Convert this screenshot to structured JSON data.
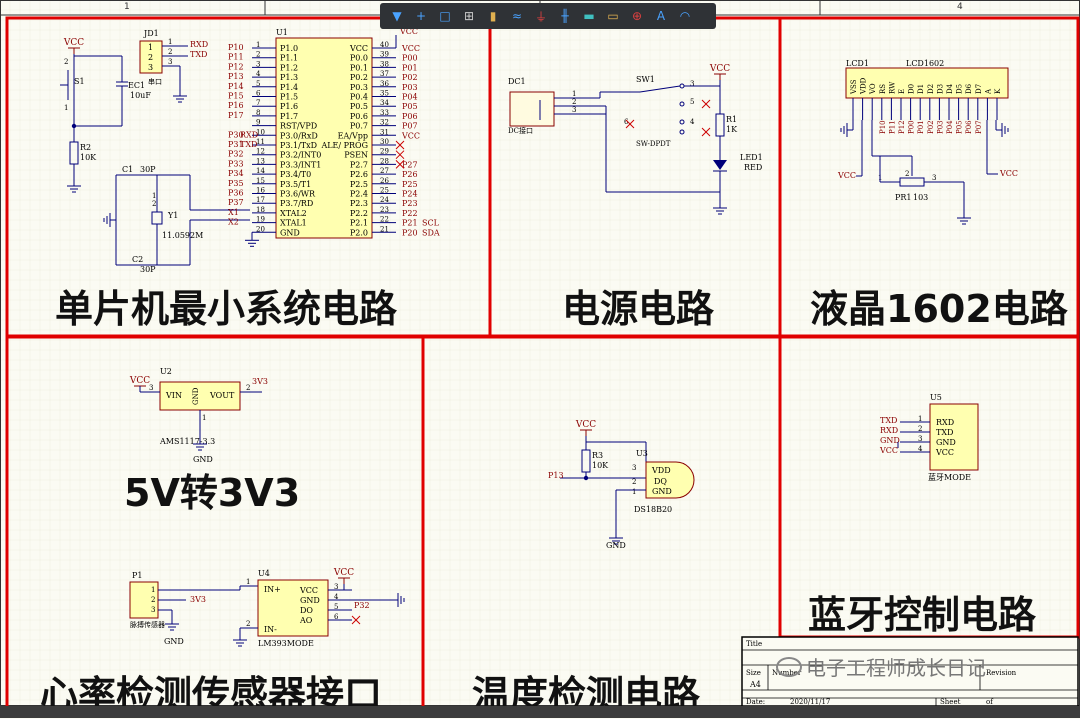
{
  "toolbar": {
    "tools": [
      {
        "name": "filter-icon",
        "glyph": "▼",
        "color": "#4aa3ff"
      },
      {
        "name": "crosshair-icon",
        "glyph": "+",
        "color": "#4aa3ff"
      },
      {
        "name": "select-rect-icon",
        "glyph": "□",
        "color": "#4aa3ff"
      },
      {
        "name": "align-icon",
        "glyph": "⊞",
        "color": "#cccccc"
      },
      {
        "name": "component-icon",
        "glyph": "▮",
        "color": "#e0b050"
      },
      {
        "name": "wire-icon",
        "glyph": "≈",
        "color": "#4aa3ff"
      },
      {
        "name": "ground-power-icon",
        "glyph": "⏚",
        "color": "#e04040"
      },
      {
        "name": "bus-icon",
        "glyph": "╫",
        "color": "#4aa3ff"
      },
      {
        "name": "sheet-symbol-icon",
        "glyph": "▬",
        "color": "#40c0c0"
      },
      {
        "name": "port-icon",
        "glyph": "▭",
        "color": "#e0b050"
      },
      {
        "name": "no-erc-icon",
        "glyph": "⊕",
        "color": "#e04040"
      },
      {
        "name": "text-icon",
        "glyph": "A",
        "color": "#4aa3ff"
      },
      {
        "name": "arc-icon",
        "glyph": "◠",
        "color": "#4aa3ff"
      }
    ]
  },
  "grid_columns": [
    "1",
    "4"
  ],
  "sections": {
    "mcu": "单片机最小系统电路",
    "power": "电源电路",
    "lcd": "液晶1602电路",
    "ldo": "5V转3V3",
    "temp": "温度检测电路",
    "bt": "蓝牙控制电路",
    "heart": "心率检测传感器接口"
  },
  "mcu": {
    "vcc": "VCC",
    "jd1": "JD1",
    "jd1_note": "串口",
    "rxd": "RXD",
    "txd": "TXD",
    "s1": "S1",
    "ec1": "EC1",
    "ec1_val": "10uF",
    "r2": "R2",
    "r2_val": "10K",
    "c1": "C1",
    "c1_val": "30P",
    "c2": "C2",
    "c2_val": "30P",
    "y1": "Y1",
    "y1_val": "11.0592M",
    "u1": "U1",
    "vcc40": "VCC",
    "pin40": "40",
    "left_nets": [
      "P10",
      "P11",
      "P12",
      "P13",
      "P14",
      "P15",
      "P16",
      "P17",
      "",
      "P30",
      "P31",
      "P32",
      "P33",
      "P34",
      "P35",
      "P36",
      "P37",
      "X1",
      "X2",
      ""
    ],
    "left_extra": [
      "",
      "",
      "",
      "",
      "",
      "",
      "",
      "",
      "",
      "RXD",
      "TXD",
      "",
      "",
      "",
      "",
      "",
      "",
      "",
      "",
      ""
    ],
    "left_nums": [
      "1",
      "2",
      "3",
      "4",
      "5",
      "6",
      "7",
      "8",
      "9",
      "10",
      "11",
      "12",
      "13",
      "14",
      "15",
      "16",
      "17",
      "18",
      "19",
      "20"
    ],
    "left_pins": [
      "P1.0",
      "P1.1",
      "P1.2",
      "P1.3",
      "P1.4",
      "P1.5",
      "P1.6",
      "P1.7",
      "RST/VPD",
      "P3.0/RxD",
      "P3.1/TxD",
      "P3.2/INT0",
      "P3.3/INT1",
      "P3.4/T0",
      "P3.5/T1",
      "P3.6/WR",
      "P3.7/RD",
      "XTAL2",
      "XTAL1",
      "GND"
    ],
    "right_pins": [
      "VCC",
      "P0.0",
      "P0.1",
      "P0.2",
      "P0.3",
      "P0.4",
      "P0.5",
      "P0.6",
      "P0.7",
      "EA/Vpp",
      "ALE/ PROG",
      "PSEN",
      "P2.7",
      "P2.6",
      "P2.5",
      "P2.4",
      "P2.3",
      "P2.2",
      "P2.1",
      "P2.0"
    ],
    "right_nums": [
      "40",
      "39",
      "38",
      "37",
      "36",
      "35",
      "34",
      "33",
      "32",
      "31",
      "30",
      "29",
      "28",
      "27",
      "26",
      "25",
      "24",
      "23",
      "22",
      "21"
    ],
    "right_nets": [
      "VCC",
      "P00",
      "P01",
      "P02",
      "P03",
      "P04",
      "P05",
      "P06",
      "P07",
      "VCC",
      "",
      "",
      "P27",
      "P26",
      "P25",
      "P24",
      "P23",
      "P22",
      "P21",
      "P20"
    ],
    "right_extra": [
      "",
      "",
      "",
      "",
      "",
      "",
      "",
      "",
      "",
      "",
      "",
      "",
      "",
      "",
      "",
      "",
      "",
      "",
      "SCL",
      "SDA"
    ]
  },
  "power": {
    "dc1": "DC1",
    "dc_label": "DC接口",
    "sw1": "SW1",
    "sw_label": "SW-DPDT",
    "vcc": "VCC",
    "r1": "R1",
    "r1_val": "1K",
    "led1": "LED1",
    "led_val": "RED"
  },
  "lcd": {
    "lcd1": "LCD1",
    "model": "LCD1602",
    "pins": [
      "VSS",
      "VDD",
      "VO",
      "RS",
      "RW",
      "E",
      "D0",
      "D1",
      "D2",
      "D3",
      "D4",
      "D5",
      "D6",
      "D7",
      "A",
      "K"
    ],
    "nets": [
      "",
      "",
      "",
      "P10",
      "P11",
      "P12",
      "P00",
      "P01",
      "P02",
      "P03",
      "P04",
      "P05",
      "P06",
      "P07",
      "",
      ""
    ],
    "vcc_left": "VCC",
    "vcc_right": "VCC",
    "pr1": "PR1",
    "pr1_val": "103",
    "n1": "1",
    "n2": "2",
    "n3": "3"
  },
  "ldo": {
    "u2": "U2",
    "vcc": "VCC",
    "vin": "VIN",
    "gnd": "GND",
    "vout": "VOUT",
    "out": "3V3",
    "model": "AMS1117-3.3",
    "pin3": "3",
    "pin1": "1",
    "pin2": "2",
    "gnd_label": "GND"
  },
  "temp": {
    "vcc": "VCC",
    "r3": "R3",
    "r3_val": "10K",
    "u3": "U3",
    "vdd": "VDD",
    "dq": "DQ",
    "gnd": "GND",
    "model": "DS18B20",
    "net": "P13",
    "p3": "3",
    "p2": "2",
    "p1": "1",
    "gnd_label": "GND"
  },
  "bt": {
    "u5": "U5",
    "model": "蓝牙MODE",
    "pins": [
      "RXD",
      "TXD",
      "GND",
      "VCC"
    ],
    "nets": [
      "TXD",
      "RXD",
      "GND",
      "VCC"
    ],
    "nums": [
      "1",
      "2",
      "3",
      "4"
    ]
  },
  "heart": {
    "p1": "P1",
    "p1_label": "脉搏传感器",
    "net3v3": "3V3",
    "gnd": "GND",
    "u4": "U4",
    "model": "LM393MODE",
    "vcc": "VCC",
    "left_pins": [
      "IN+",
      "IN-"
    ],
    "right_pins": [
      "VCC",
      "GND",
      "DO",
      "AO"
    ],
    "right_nums": [
      "3",
      "4",
      "5",
      "6"
    ],
    "left_nums": [
      "1",
      "2"
    ],
    "net_do": "P32"
  },
  "titleblock": {
    "title": "Title",
    "size": "Size",
    "number": "Number",
    "revision": "Revision",
    "a4": "A4",
    "date_label": "Date:",
    "date": "2020/11/17",
    "sheet": "Sheet",
    "of": "of"
  },
  "watermark": "电子工程师成长日记"
}
